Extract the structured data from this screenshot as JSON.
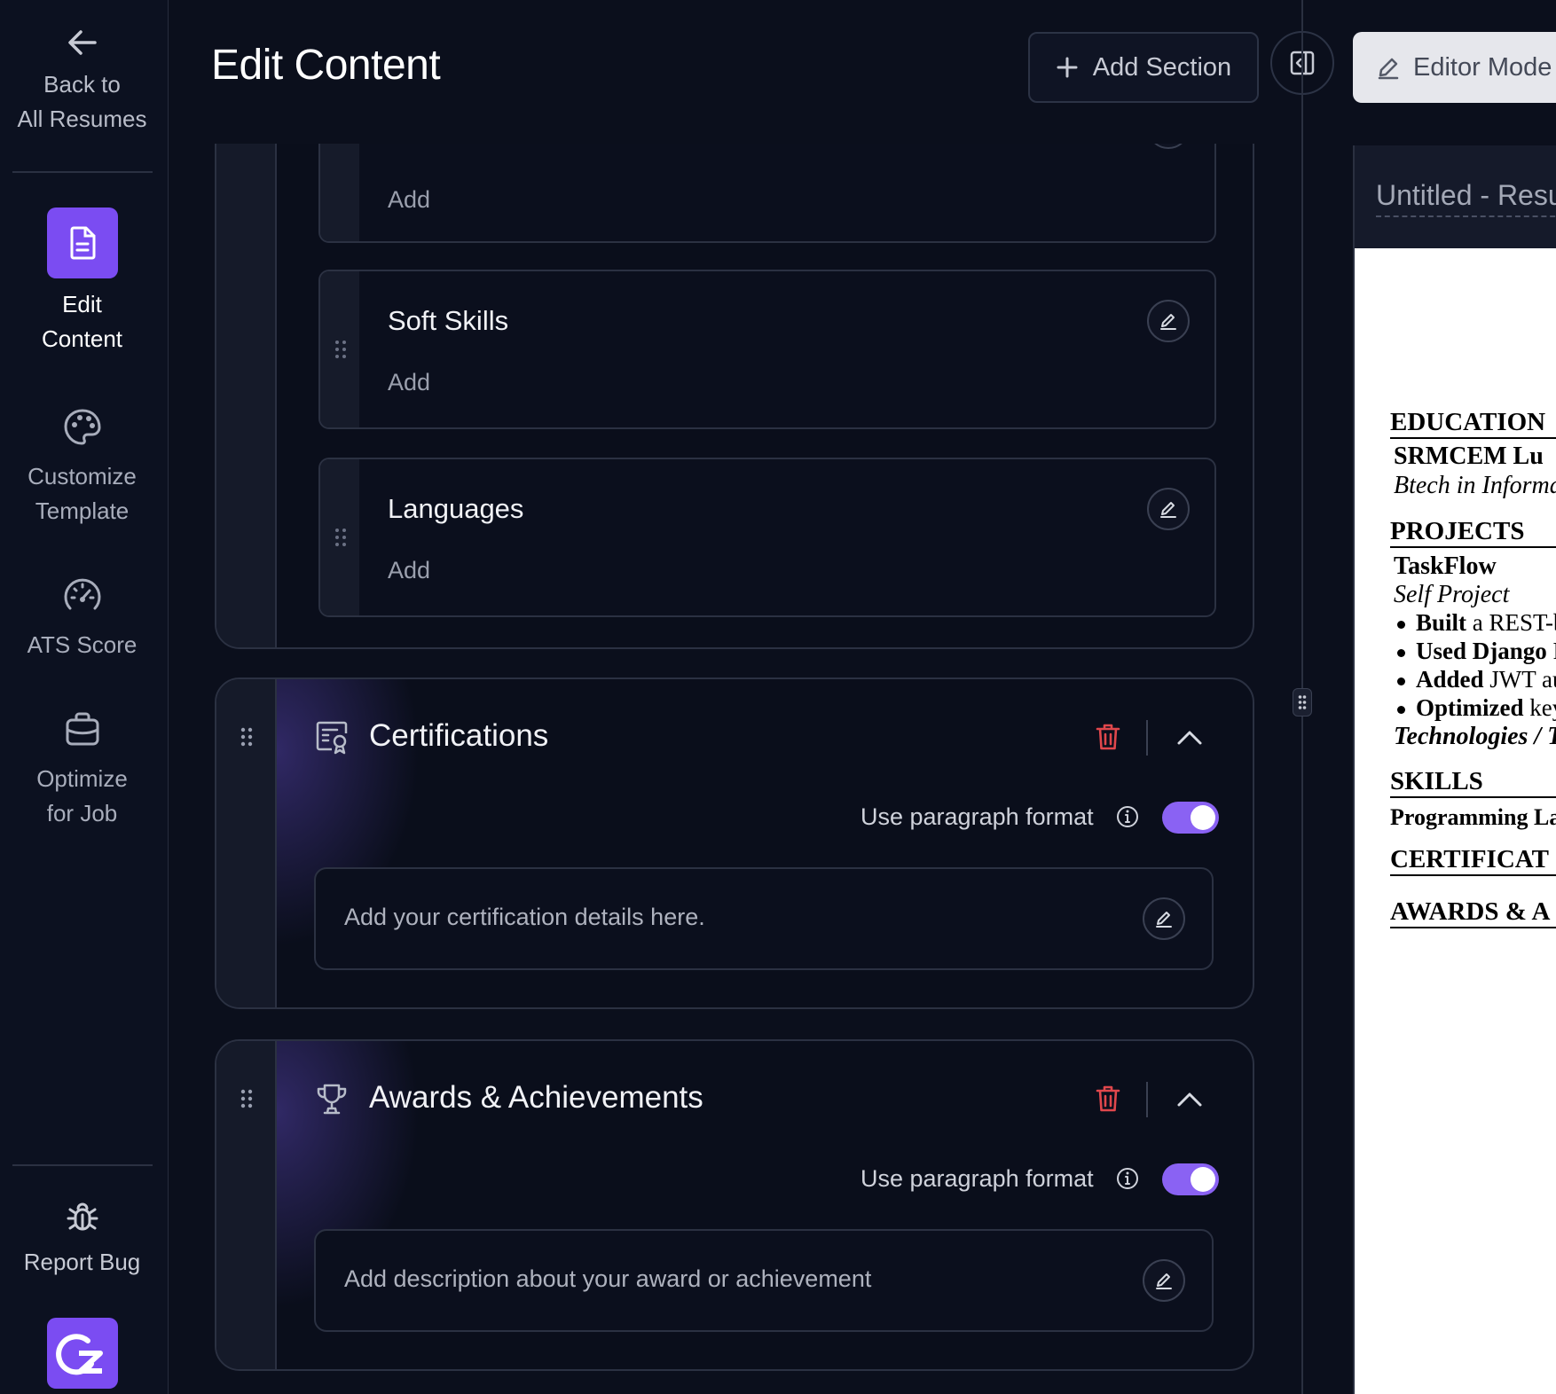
{
  "sidebar": {
    "back_label_line1": "Back to",
    "back_label_line2": "All Resumes",
    "items": [
      {
        "label_line1": "Edit",
        "label_line2": "Content",
        "icon": "document-icon",
        "active": true
      },
      {
        "label_line1": "Customize",
        "label_line2": "Template",
        "icon": "palette-icon",
        "active": false
      },
      {
        "label_line1": "ATS Score",
        "label_line2": "",
        "icon": "gauge-icon",
        "active": false
      },
      {
        "label_line1": "Optimize",
        "label_line2": "for Job",
        "icon": "briefcase-icon",
        "active": false
      }
    ],
    "report_bug_label": "Report Bug",
    "logo_icon": "gz-logo"
  },
  "header": {
    "title": "Edit Content",
    "add_section_label": "Add Section",
    "editor_mode_label": "Editor Mode"
  },
  "skills_subsections": [
    {
      "title": "",
      "add_label": "Add"
    },
    {
      "title": "Soft Skills",
      "add_label": "Add"
    },
    {
      "title": "Languages",
      "add_label": "Add"
    }
  ],
  "sections": [
    {
      "title": "Certifications",
      "icon": "certificate-icon",
      "paragraph_label": "Use paragraph format",
      "paragraph_enabled": true,
      "placeholder": "Add your certification details here."
    },
    {
      "title": "Awards & Achievements",
      "icon": "trophy-icon",
      "paragraph_label": "Use paragraph format",
      "paragraph_enabled": true,
      "placeholder": "Add description about your award or achievement"
    }
  ],
  "preview": {
    "doc_title": "Untitled - Resu",
    "resume": {
      "education_heading": "EDUCATION",
      "school": "SRMCEM Lu",
      "degree": "Btech in Informa",
      "projects_heading": "PROJECTS",
      "project_name": "TaskFlow",
      "project_type": "Self Project",
      "bullets": [
        {
          "bold": "Built",
          "rest": " a REST-b"
        },
        {
          "bold": "Used Django",
          "rest": " R"
        },
        {
          "bold": "Added",
          "rest": " JWT au"
        },
        {
          "bold": "Optimized",
          "rest": " key"
        }
      ],
      "technologies": "Technologies / T",
      "skills_heading": "SKILLS",
      "skills_line": "Programming La",
      "certifications_heading": "CERTIFICAT",
      "awards_heading": "AWARDS & A"
    }
  },
  "colors": {
    "accent": "#7b4cf2",
    "toggle_on": "#8a62f3",
    "danger": "#e0474c",
    "background": "#0b0f1c"
  }
}
